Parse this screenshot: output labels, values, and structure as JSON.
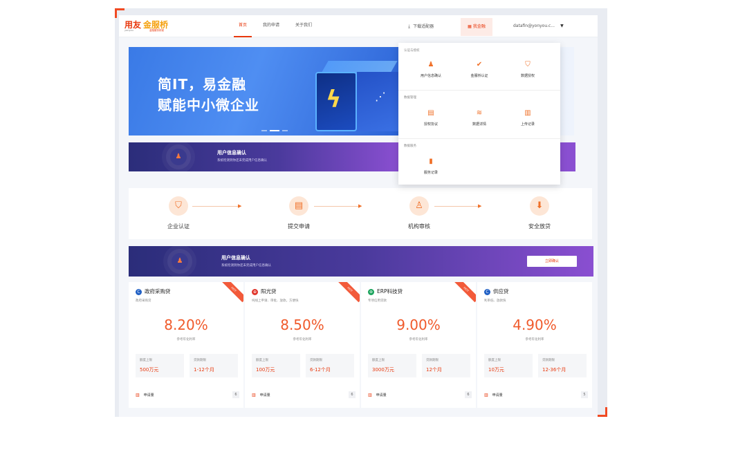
{
  "header": {
    "logo_main": "用友",
    "logo_gold": "金服桥",
    "logo_sub": "yonyou",
    "logo_sub2": "金融服务桥梁",
    "nav": [
      "首页",
      "我的申请",
      "关于我们"
    ],
    "download_label": "下载适配器",
    "myfin_label": "我金融",
    "user_email": "datafin@yonyou.c..."
  },
  "banner": {
    "line1": "简IT，易金融",
    "line2": "赋能中小微企业"
  },
  "dropdown": {
    "sections": [
      {
        "title": "认证与授权",
        "items": [
          "用户信息确认",
          "金服桥认证",
          "数据授权"
        ]
      },
      {
        "title": "数据管理",
        "items": [
          "授权协议",
          "数据详情",
          "上传记录"
        ]
      },
      {
        "title": "数据服务",
        "items": [
          "服务记录"
        ]
      }
    ]
  },
  "confirm_small": {
    "title": "用户信息确认",
    "desc": "系统检测到你还未完成用户信息确认"
  },
  "steps": [
    "企业认证",
    "提交申请",
    "机构审核",
    "安全放贷"
  ],
  "confirm": {
    "title": "用户信息确认",
    "desc": "系统检测到你还未完成用户信息确认",
    "button": "立即确认"
  },
  "products": [
    {
      "name": "政府采购贷",
      "sub": "政府采购贷",
      "rate": "8.20%",
      "rate_label": "参考年化利率",
      "limit_k": "额度上限",
      "limit_v": "500万元",
      "term_k": "贷款期限",
      "term_v": "1-12个月",
      "foot": "申请量",
      "count": "6",
      "ribbon": "HOT"
    },
    {
      "name": "阳光贷",
      "sub": "纯线上申请、审批、放款，方便快",
      "rate": "8.50%",
      "rate_label": "参考年化利率",
      "limit_k": "额度上限",
      "limit_v": "100万元",
      "term_k": "贷款期限",
      "term_v": "6-12个月",
      "foot": "申请量",
      "count": "6",
      "ribbon": "HOT"
    },
    {
      "name": "ERP科技贷",
      "sub": "专项信用贷款",
      "rate": "9.00%",
      "rate_label": "参考年化利率",
      "limit_k": "额度上限",
      "limit_v": "3000万元",
      "term_k": "贷款期限",
      "term_v": "12个月",
      "foot": "申请量",
      "count": "6",
      "ribbon": "HOT"
    },
    {
      "name": "供应贷",
      "sub": "利率低、放款快",
      "rate": "4.90%",
      "rate_label": "参考年化利率",
      "limit_k": "额度上限",
      "limit_v": "10万元",
      "term_k": "贷款期限",
      "term_v": "12-36个月",
      "foot": "申请量",
      "count": "5",
      "ribbon": ""
    }
  ]
}
